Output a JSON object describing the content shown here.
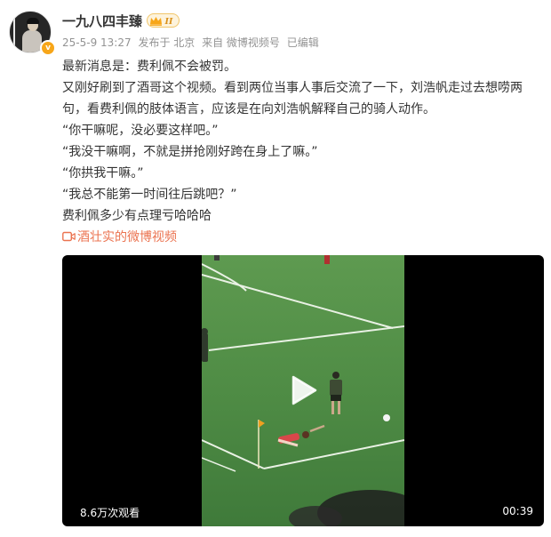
{
  "post": {
    "author": {
      "name": "一九八四丰臻",
      "member_level": "II",
      "verified_mark": "v"
    },
    "meta": {
      "date": "25-5-9 13:27",
      "location": "发布于 北京",
      "source": "来自 微博视频号",
      "status": "已编辑"
    },
    "paragraphs": [
      "最新消息是：费利佩不会被罚。",
      "又刚好刷到了酒哥这个视频。看到两位当事人事后交流了一下，刘浩帆走过去想唠两句，看费利佩的肢体语言，应该是在向刘浩帆解释自己的骑人动作。",
      "“你干嘛呢，没必要这样吧。”",
      "“我没干嘛啊，不就是拼抢刚好跨在身上了嘛。”",
      "“你拱我干嘛。”",
      "“我总不能第一时间往后跳吧？”",
      "费利佩多少有点理亏哈哈哈"
    ],
    "video_link": {
      "icon": "video-camera-icon",
      "label": "酒壮实的微博视频"
    },
    "video": {
      "views": "8.6万次观看",
      "duration": "00:39"
    }
  },
  "colors": {
    "link": "#eb7350",
    "meta": "#939393",
    "text": "#333333",
    "badge_gold": "#f7a619"
  }
}
